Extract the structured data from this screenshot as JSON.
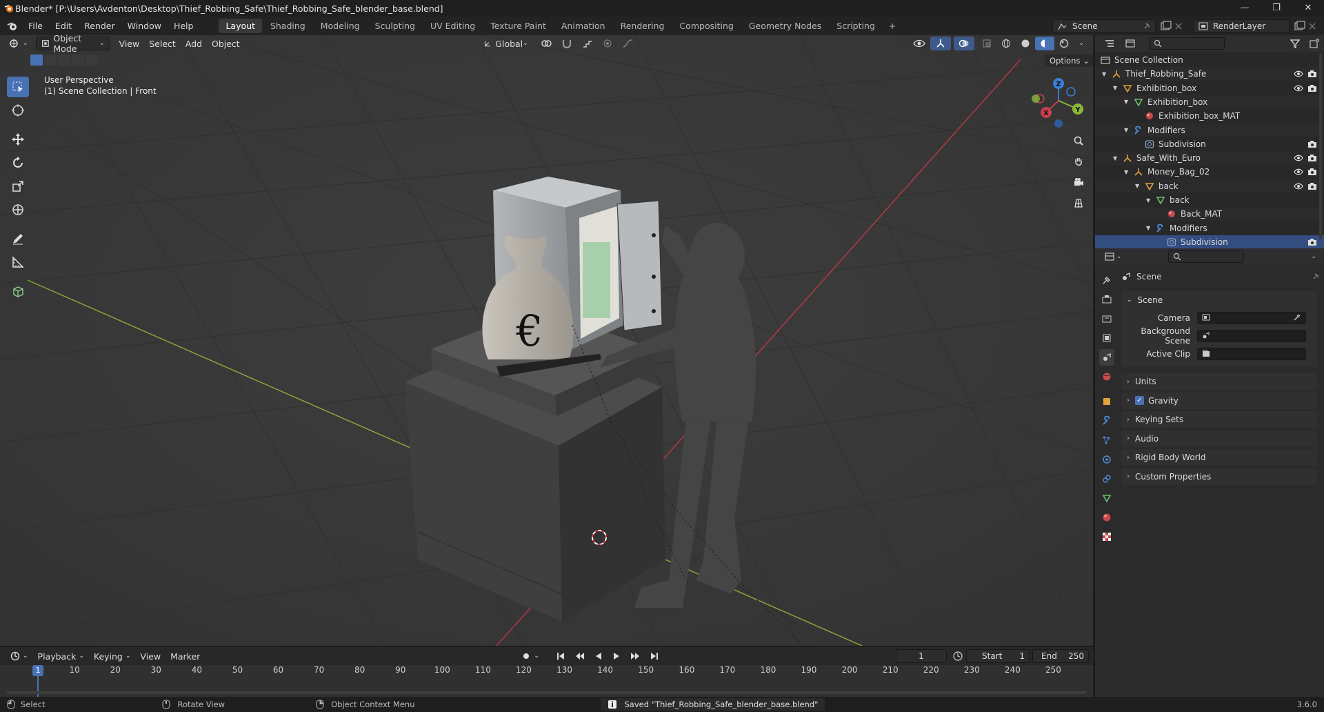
{
  "window": {
    "title": "Blender* [P:\\Users\\Avdenton\\Desktop\\Thief_Robbing_Safe\\Thief_Robbing_Safe_blender_base.blend]",
    "min_glyph": "—",
    "max_glyph": "❐",
    "close_glyph": "✕"
  },
  "menus": [
    "File",
    "Edit",
    "Render",
    "Window",
    "Help"
  ],
  "workspaces": [
    "Layout",
    "Shading",
    "Modeling",
    "Sculpting",
    "UV Editing",
    "Texture Paint",
    "Animation",
    "Rendering",
    "Compositing",
    "Geometry Nodes",
    "Scripting"
  ],
  "workspace_add": "+",
  "scene_name": "Scene",
  "render_layer": "RenderLayer",
  "viewport": {
    "mode": "Object Mode",
    "menus": [
      "View",
      "Select",
      "Add",
      "Object"
    ],
    "transform": "Global",
    "options": "Options",
    "info_line1": "User Perspective",
    "info_line2": "(1) Scene Collection | Front",
    "gizmo": {
      "x": "X",
      "y": "Y",
      "z": "Z"
    }
  },
  "outliner": {
    "rows": [
      {
        "label": "Scene Collection",
        "depth": 0,
        "kind": "collection",
        "vis": false,
        "cam": false
      },
      {
        "label": "Thief_Robbing_Safe",
        "depth": 1,
        "kind": "empty",
        "vis": true,
        "cam": true
      },
      {
        "label": "Exhibition_box",
        "depth": 2,
        "kind": "mesh-object",
        "vis": true,
        "cam": true
      },
      {
        "label": "Exhibition_box",
        "depth": 3,
        "kind": "mesh-data",
        "vis": false,
        "cam": false
      },
      {
        "label": "Exhibition_box_MAT",
        "depth": 4,
        "kind": "material",
        "vis": false,
        "cam": false
      },
      {
        "label": "Modifiers",
        "depth": 3,
        "kind": "wrench",
        "vis": false,
        "cam": false
      },
      {
        "label": "Subdivision",
        "depth": 4,
        "kind": "modifier",
        "vis": false,
        "cam": true
      },
      {
        "label": "Safe_With_Euro",
        "depth": 2,
        "kind": "empty",
        "vis": true,
        "cam": true
      },
      {
        "label": "Money_Bag_02",
        "depth": 3,
        "kind": "empty",
        "vis": true,
        "cam": true
      },
      {
        "label": "back",
        "depth": 4,
        "kind": "mesh-object",
        "vis": true,
        "cam": true
      },
      {
        "label": "back",
        "depth": 5,
        "kind": "mesh-data",
        "vis": false,
        "cam": false
      },
      {
        "label": "Back_MAT",
        "depth": 6,
        "kind": "material",
        "vis": false,
        "cam": false
      },
      {
        "label": "Modifiers",
        "depth": 5,
        "kind": "wrench",
        "vis": false,
        "cam": false
      },
      {
        "label": "Subdivision",
        "depth": 6,
        "kind": "modifier",
        "vis": false,
        "cam": true,
        "selected": true
      }
    ]
  },
  "properties": {
    "context": "Scene",
    "panel_title": "Scene",
    "fields": [
      {
        "label": "Camera",
        "value": ""
      },
      {
        "label": "Background Scene",
        "value": ""
      },
      {
        "label": "Active Clip",
        "value": ""
      }
    ],
    "sections": [
      {
        "label": "Units",
        "checkbox": false
      },
      {
        "label": "Gravity",
        "checkbox": true
      },
      {
        "label": "Keying Sets",
        "checkbox": false
      },
      {
        "label": "Audio",
        "checkbox": false
      },
      {
        "label": "Rigid Body World",
        "checkbox": false
      },
      {
        "label": "Custom Properties",
        "checkbox": false
      }
    ]
  },
  "timeline": {
    "menus": [
      "Playback",
      "Keying",
      "View",
      "Marker"
    ],
    "current_frame": "1",
    "start_label": "Start",
    "start": "1",
    "end_label": "End",
    "end": "250",
    "ticks": [
      "10",
      "20",
      "30",
      "40",
      "50",
      "60",
      "70",
      "80",
      "90",
      "100",
      "110",
      "120",
      "130",
      "140",
      "150",
      "160",
      "170",
      "180",
      "190",
      "200",
      "210",
      "220",
      "230",
      "240",
      "250"
    ],
    "playhead": "1"
  },
  "status": {
    "select": "Select",
    "rotate": "Rotate View",
    "context_menu": "Object Context Menu",
    "message": "Saved \"Thief_Robbing_Safe_blender_base.blend\"",
    "version": "3.6.0"
  },
  "colors": {
    "accent": "#4772b3",
    "axis_x": "#c7404f",
    "axis_y": "#8ab83a",
    "axis_z": "#3a7ed8",
    "orange": "#e59f3c",
    "green": "#6fbf6f",
    "material": "#c74a4a"
  }
}
